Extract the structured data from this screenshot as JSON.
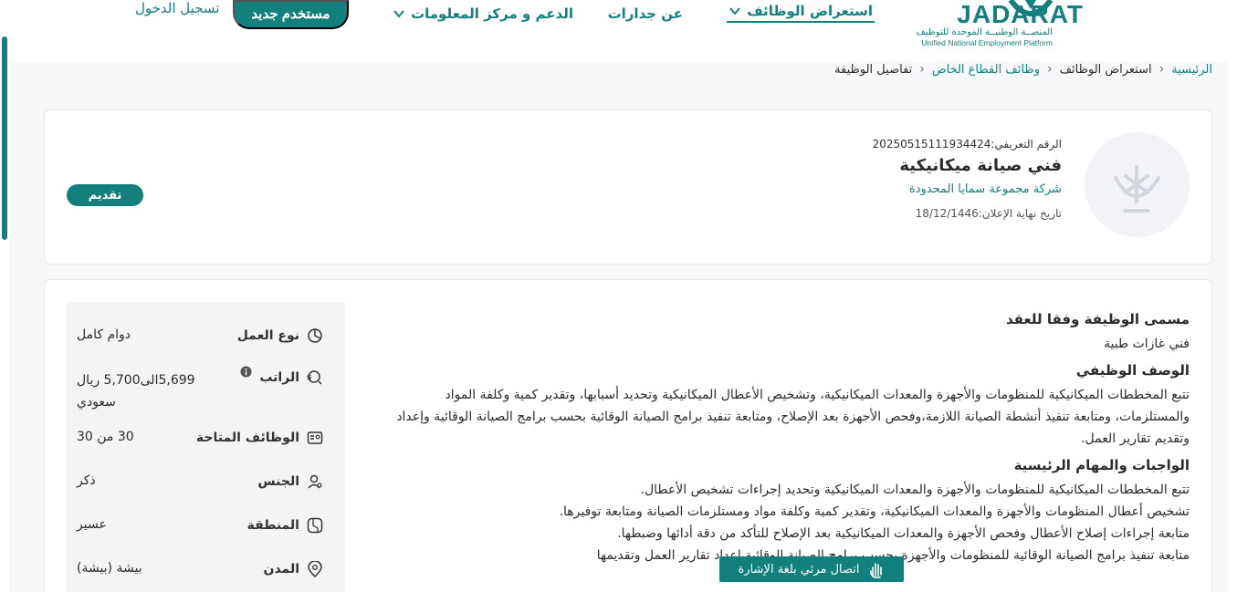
{
  "header": {
    "logo_text": "JADARAT",
    "logo_ar": "المنصــة الوطنيــة الموحدة للتوظيف",
    "logo_en": "Unified National Employment Platform",
    "nav": [
      {
        "label": "استعراض الوظائف",
        "active": true,
        "dropdown": true
      },
      {
        "label": "عن جدارات",
        "active": false,
        "dropdown": false
      },
      {
        "label": "الدعم و مركز المعلومات",
        "active": false,
        "dropdown": true
      }
    ],
    "new_user_label": "مستخدم جديد",
    "login_label": "تسجيل الدخول"
  },
  "breadcrumb": [
    "الرئيسية",
    "استعراض الوظائف",
    "وظائف القطاع الخاص",
    "تفاصيل الوظيفة"
  ],
  "job": {
    "id_label": "الرقم التعريفي:",
    "id_value": "20250515111934424",
    "title": "فني صيانة ميكانيكية",
    "company": "شركة مجموعة سمايا المحدودة",
    "deadline_label": "تاريخ نهاية الإعلان:",
    "deadline_value": "18/12/1446",
    "apply_label": "تقديم"
  },
  "attributes": [
    {
      "label": "نوع العمل",
      "value": "دوام كامل",
      "icon": "pie-icon"
    },
    {
      "label": "الراتب",
      "value": "5,699الى5,700 ريال سعودي",
      "icon": "salary-icon"
    },
    {
      "label": "الوظائف المتاحة",
      "value": "30 من 30",
      "icon": "id-card-icon"
    },
    {
      "label": "الجنس",
      "value": "ذكر",
      "icon": "gender-icon"
    },
    {
      "label": "المنطقة",
      "value": "عسير",
      "icon": "map-icon"
    },
    {
      "label": "المدن",
      "value": "بيشة (بيشة)",
      "icon": "location-pin-icon"
    }
  ],
  "content": {
    "contract_title_heading": "مسمى الوظيفة وفقا للعقد",
    "contract_title": "فني غازات طبية",
    "description_heading": "الوصف الوظيفي",
    "description": "تتبع المخططات الميكانيكية للمنظومات والأجهزة والمعدات الميكانيكية، وتشخيص الأعطال الميكانيكية وتحديد أسبابها، وتقدير كمية وكلفة المواد والمستلزمات، ومتابعة تنفيذ أنشطة الصيانة اللازمة،وفحص الأجهزة بعد الإصلاح، ومتابعة تنفيذ برامج الصيانة الوقائية بحسب برامج الصيانة الوقائية وإعداد وتقديم تقارير العمل.",
    "duties_heading": "الواجبات والمهام الرئيسية",
    "duties": [
      "تتبع المخططات الميكانيكية للمنظومات والأجهزة والمعدات الميكانيكية وتحديد إجراءات تشخيص الأعطال.",
      "تشخيص أعطال المنظومات والأجهزة والمعدات الميكانيكية، وتقدير كمية وكلفة مواد ومستلزمات الصيانة ومتابعة توفيرها.",
      "متابعة إجراءات إصلاح الأعطال وفحص الأجهزة والمعدات الميكانيكية بعد الإصلاح للتأكد من دقة أدائها وضبطها.",
      "متابعة تنفيذ برامج الصيانة الوقائية للمنظومات والأجهزة بحسب برامج الصيانة الوقائية،إعداد تقارير العمل وتقديمها"
    ]
  },
  "sign_language_label": "اتصال مرئي بلغة الإشارة",
  "colors": {
    "accent": "#14807d"
  }
}
